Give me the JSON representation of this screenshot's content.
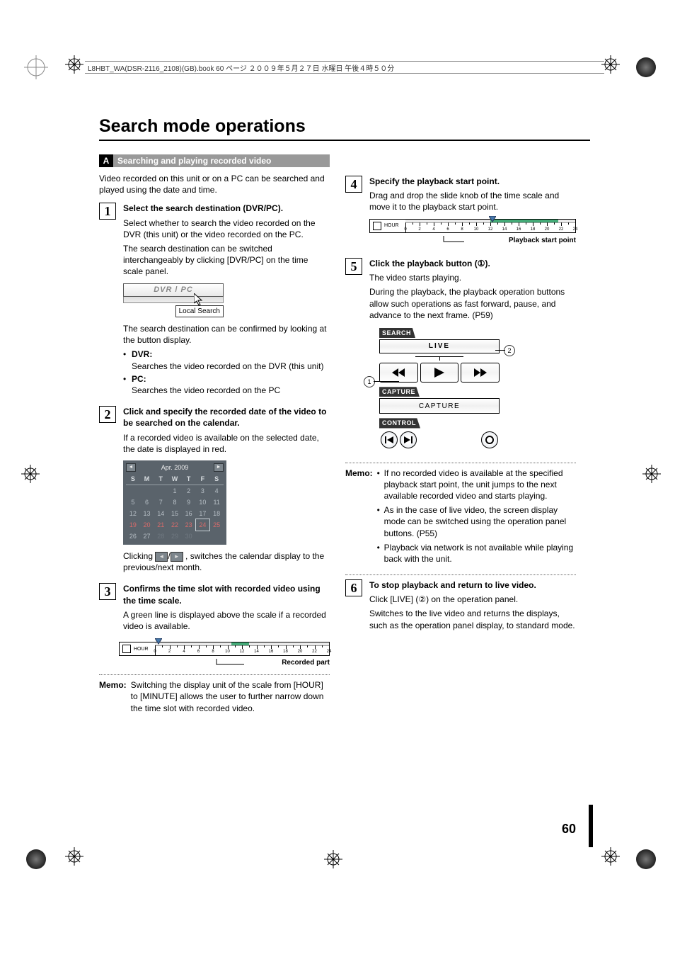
{
  "meta": {
    "book_header": "L8HBT_WA(DSR-2116_2108)(GB).book  60 ページ  ２００９年５月２７日  水曜日  午後４時５０分"
  },
  "title": "Search mode operations",
  "section": {
    "tag": "A",
    "title": "Searching and playing recorded video"
  },
  "intro": "Video recorded on this unit or on a PC can be searched and played using the date and time.",
  "steps": {
    "1": {
      "head": "Select the search destination (DVR/PC).",
      "p1": "Select whether to search the video recorded on the DVR (this unit) or the video recorded on the PC.",
      "p2": "The search destination can be switched interchangeably by clicking  [DVR/PC] on the time scale panel.",
      "p3": "The search destination can be confirmed by looking at the button display.",
      "b1_head": "DVR:",
      "b1_body": "Searches the video recorded on the DVR (this unit)",
      "b2_head": "PC:",
      "b2_body": "Searches the video recorded on the PC"
    },
    "2": {
      "head": "Click and specify the recorded date of the video to be searched on the calendar.",
      "p1": "If a recorded video is available on the selected date, the date is displayed in red.",
      "p2_a": "Clicking ",
      "p2_b": " , switches the calendar display to the previous/next month."
    },
    "3": {
      "head": "Confirms the time slot with recorded video using the time scale.",
      "p1": "A green line is displayed above the scale if a recorded video is available.",
      "callout": "Recorded part"
    },
    "4": {
      "head": "Specify the playback start point.",
      "p1": "Drag and drop the slide knob of the time scale and move it to the playback start point.",
      "callout": "Playback start point"
    },
    "5": {
      "head": "Click the playback button (①).",
      "p1": "The video starts playing.",
      "p2": "During the playback, the playback operation buttons allow such operations as fast forward, pause, and advance to the next frame. (P59)"
    },
    "6": {
      "head": "To stop playback and return to live video.",
      "p1": "Click [LIVE] (②) on the operation panel.",
      "p2": "Switches to the live video and returns the displays, such as the operation panel display, to standard mode."
    }
  },
  "fig_dvrpc": {
    "dvr": "DVR",
    "pc": "PC",
    "tooltip": "Local Search"
  },
  "calendar": {
    "month": "Apr. 2009",
    "dow": [
      "S",
      "M",
      "T",
      "W",
      "T",
      "F",
      "S"
    ],
    "cells": [
      [
        "",
        "",
        "",
        "1",
        "2",
        "3",
        "4"
      ],
      [
        "5",
        "6",
        "7",
        "8",
        "9",
        "10",
        "11"
      ],
      [
        "12",
        "13",
        "14",
        "15",
        "16",
        "17",
        "18"
      ],
      [
        "19",
        "20",
        "21",
        "22",
        "23",
        "24",
        "25"
      ],
      [
        "26",
        "27",
        "28",
        "29",
        "30",
        "",
        ""
      ]
    ]
  },
  "timescale": {
    "label": "HOUR",
    "ticks": [
      "0",
      "2",
      "4",
      "6",
      "8",
      "10",
      "12",
      "14",
      "16",
      "18",
      "20",
      "22",
      "24"
    ]
  },
  "panel": {
    "search": "SEARCH",
    "live": "LIVE",
    "capture_lbl": "CAPTURE",
    "capture_btn": "CAPTURE",
    "control": "CONTROL"
  },
  "memo": {
    "label": "Memo:",
    "left": "Switching the display unit of the scale from [HOUR] to [MINUTE] allows the user to further narrow down the time slot with recorded video.",
    "right": {
      "i1": "If no recorded video is available at the specified playback start point, the unit jumps to the next available recorded video and starts playing.",
      "i2": "As in the case of live video, the screen display mode can be switched using the operation panel buttons. (P55)",
      "i3": "Playback via network is not available while playing back with the unit."
    }
  },
  "page_number": "60"
}
